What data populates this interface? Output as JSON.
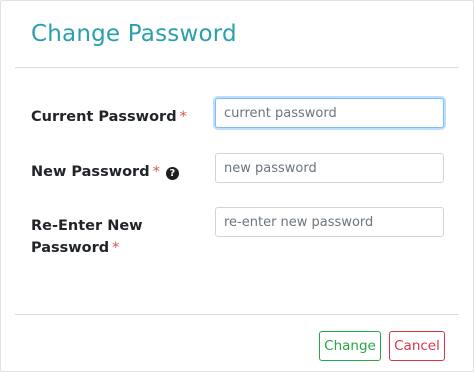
{
  "dialog": {
    "title": "Change Password",
    "fields": [
      {
        "label": "Current Password",
        "required_mark": "*",
        "placeholder": "current password",
        "value": ""
      },
      {
        "label": "New Password",
        "required_mark": "*",
        "help_icon": "question-circle-icon",
        "placeholder": "new password",
        "value": ""
      },
      {
        "label_line1": "Re-Enter New",
        "label_line2": "Password",
        "required_mark": "*",
        "placeholder": "re-enter new password",
        "value": ""
      }
    ],
    "buttons": {
      "change": "Change",
      "cancel": "Cancel"
    }
  },
  "colors": {
    "title": "#2a9fae",
    "required": "#d9534f",
    "change": "#28a745",
    "cancel": "#dc3545",
    "focus": "#80bdff"
  }
}
